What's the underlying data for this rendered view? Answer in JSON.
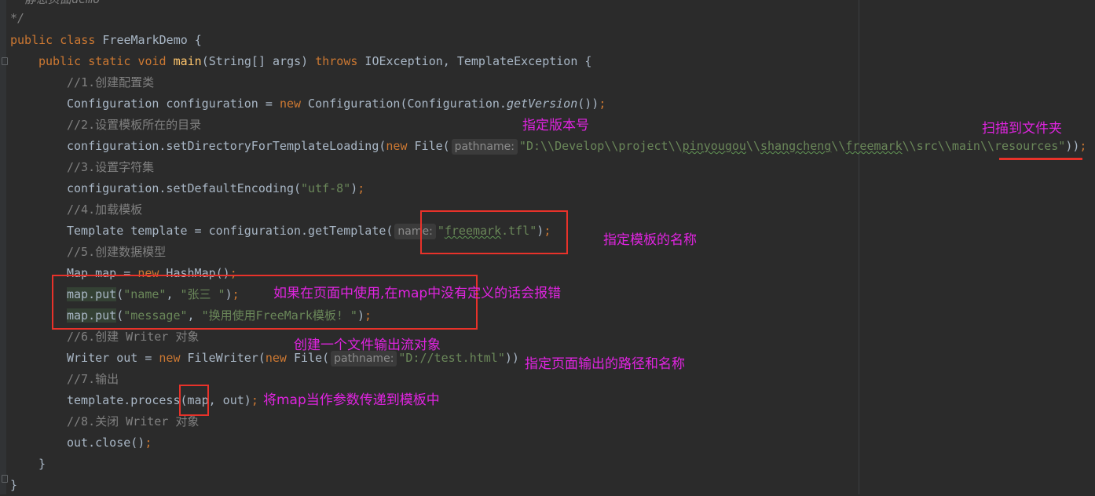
{
  "code": {
    "comment_top": "* 静态页面demo",
    "comment_end": "*/",
    "class_decl": {
      "kw1": "public",
      "kw2": "class",
      "name": "FreeMarkDemo",
      "brace": " {"
    },
    "main_decl": {
      "kw1": "public",
      "kw2": "static",
      "kw3": "void",
      "name": "main",
      "params": "(String[] args) ",
      "throws": "throws",
      "exceptions": " IOException, TemplateException {"
    },
    "c1": "//1.创建配置类",
    "l1": {
      "a": "Configuration configuration = ",
      "new": "new",
      "b": " Configuration(Configuration.",
      "call": "getVersion",
      "c": "())",
      "semi": ";"
    },
    "c2": "//2.设置模板所在的目录",
    "l2": {
      "a": "configuration.setDirectoryForTemplateLoading(",
      "new": "new",
      "b": " File(",
      "hint": "pathname:",
      "s1": "\"D:\\\\Develop\\\\project\\\\",
      "s2": "pinyougou",
      "s3": "\\\\",
      "s4": "shangcheng",
      "s5": "\\\\",
      "s6": "freemark",
      "s7": "\\\\src\\\\main\\\\resources\"",
      "c": "))",
      "semi": ";"
    },
    "c3": "//3.设置字符集",
    "l3": {
      "a": "configuration.setDefaultEncoding(",
      "str": "\"utf-8\"",
      "c": ")",
      "semi": ";"
    },
    "c4": "//4.加载模板",
    "l4": {
      "a": "Template template = configuration.getTemplate(",
      "hint": "name:",
      "s1": "\"",
      "s2": "freemark",
      "s3": ".tfl\"",
      "c": ")",
      "semi": ";"
    },
    "c5": "//5.创建数据模型",
    "l5": {
      "a": "Map map = ",
      "new": "new",
      "b": " HashMap()",
      "semi": ";"
    },
    "l6": {
      "a": "map.put",
      "b": "(",
      "s1": "\"name\"",
      "comma": ", ",
      "s2": "\"张三 \"",
      "c": ")",
      "semi": ";"
    },
    "l7": {
      "a": "map.put",
      "b": "(",
      "s1": "\"message\"",
      "comma": ", ",
      "s2": "\"换用使用FreeMark模板! \"",
      "c": ")",
      "semi": ";"
    },
    "c6": "//6.创建 Writer 对象",
    "l8": {
      "a": "Writer out = ",
      "new": "new",
      "b": " FileWriter(",
      "new2": "new",
      "c": " File(",
      "hint": "pathname:",
      "str": "\"D://test.html\"",
      "d": "))"
    },
    "c7": "//7.输出",
    "l9": {
      "a": "template.process(map, out)",
      "semi": ";"
    },
    "c8": "//8.关闭 Writer 对象",
    "l10": {
      "a": "out.close()",
      "semi": ";"
    },
    "close1": "}",
    "close2": "}"
  },
  "annotations": {
    "version": "指定版本号",
    "folder": "扫描到文件夹",
    "template_name": "指定模板的名称",
    "map_error": "如果在页面中使用,在map中没有定义的话会报错",
    "writer": "创建一个文件输出流对象",
    "output_path": "指定页面输出的路径和名称",
    "map_param": "将map当作参数传递到模板中"
  },
  "colors": {
    "background": "#2b2b2b",
    "keyword": "#cc7832",
    "string": "#6a8759",
    "comment": "#808080",
    "method": "#ffc66d",
    "annotation": "#e024e0",
    "highlight_box": "#e8322a"
  }
}
